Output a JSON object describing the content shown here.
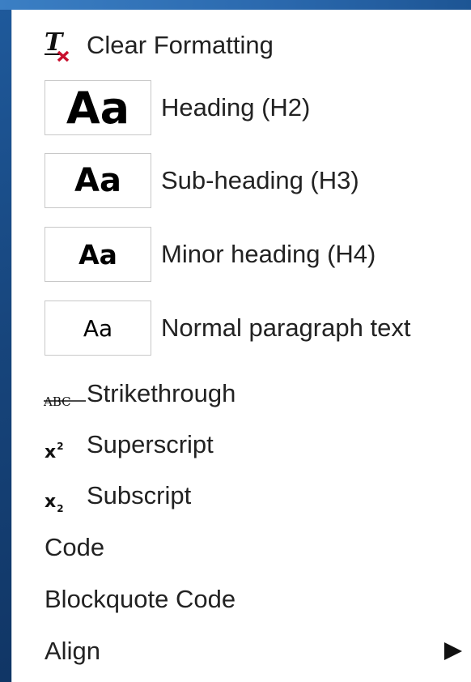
{
  "menu": {
    "clear_formatting": {
      "label": "Clear Formatting",
      "icon": "clear-formatting-icon",
      "glyph": "T"
    },
    "heading_h2": {
      "preview": "Aa",
      "label": "Heading (H2)"
    },
    "subheading_h3": {
      "preview": "Aa",
      "label": "Sub-heading (H3)"
    },
    "minor_heading_h4": {
      "preview": "Aa",
      "label": "Minor heading (H4)"
    },
    "normal_paragraph": {
      "preview": "Aa",
      "label": "Normal paragraph text"
    },
    "strikethrough": {
      "label": "Strikethrough",
      "icon": "strikethrough-icon",
      "glyph": "ABC"
    },
    "superscript": {
      "label": "Superscript",
      "icon": "superscript-icon",
      "glyph_base": "x",
      "glyph_sup": "2"
    },
    "subscript": {
      "label": "Subscript",
      "icon": "subscript-icon",
      "glyph_base": "x",
      "glyph_sub": "2"
    },
    "code": {
      "label": "Code"
    },
    "blockquote_code": {
      "label": "Blockquote Code"
    },
    "align": {
      "label": "Align",
      "submenu_icon": "submenu-arrow-icon"
    }
  },
  "colors": {
    "background_blue": "#17457c",
    "menu_bg": "#ffffff",
    "text": "#222222",
    "clear_x_red": "#c8102e"
  }
}
